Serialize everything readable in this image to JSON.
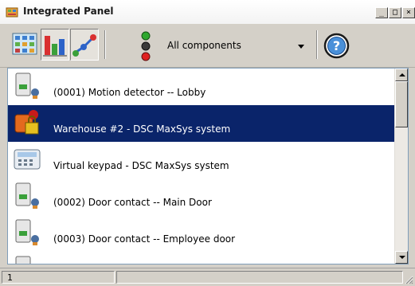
{
  "window": {
    "title": "Integrated Panel",
    "icon": "app-panel-icon",
    "controls": {
      "minimize": "_",
      "maximize": "□",
      "close": "×"
    }
  },
  "toolbar": {
    "tools": [
      {
        "name": "topology-view",
        "icon": "topology-icon",
        "pressed": false
      },
      {
        "name": "chart-view",
        "icon": "bar-chart-icon",
        "pressed": true
      },
      {
        "name": "components-view",
        "icon": "component-links-icon",
        "pressed": true
      }
    ],
    "filter_icon": "traffic-light-icon",
    "filter_label": "All components",
    "help_icon": "help-icon"
  },
  "list": {
    "items": [
      {
        "label": "(0001) Motion detector -- Lobby",
        "icon": "sensor-device-icon",
        "selected": false
      },
      {
        "label": "Warehouse #2 - DSC MaxSys system",
        "icon": "alarm-system-icon",
        "selected": true
      },
      {
        "label": "Virtual keypad - DSC MaxSys system",
        "icon": "keypad-icon",
        "selected": false
      },
      {
        "label": "(0002) Door contact -- Main Door",
        "icon": "sensor-device-icon",
        "selected": false
      },
      {
        "label": "(0003) Door contact -- Employee door",
        "icon": "sensor-device-icon",
        "selected": false
      },
      {
        "label": "",
        "icon": "sensor-device-icon",
        "selected": false
      }
    ]
  },
  "statusbar": {
    "count": "1"
  },
  "colors": {
    "selection": "#0a246a",
    "window_bg": "#d4d0c8",
    "list_bg": "#ffffff"
  }
}
